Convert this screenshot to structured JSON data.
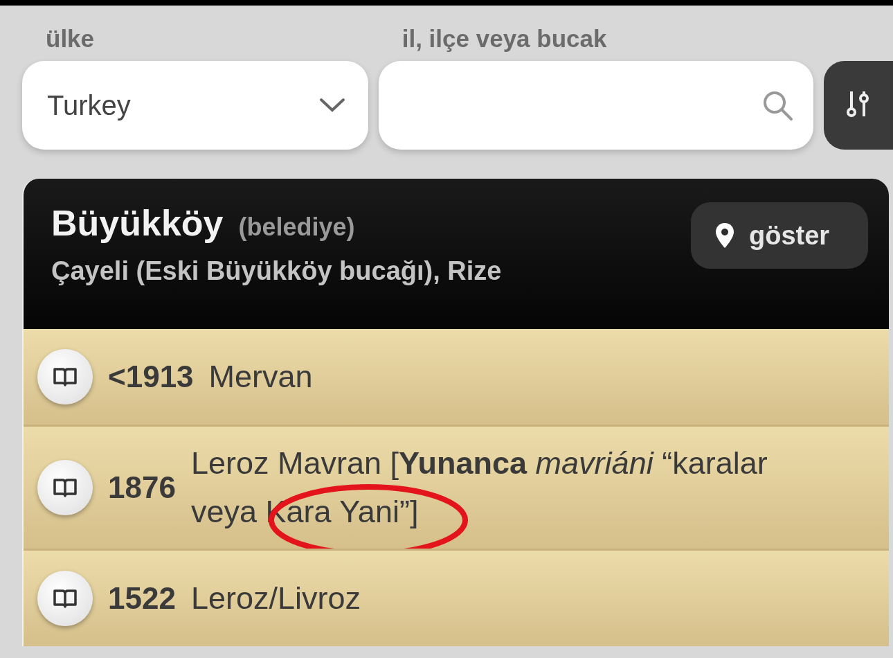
{
  "country_field": {
    "label": "ülke",
    "value": "Turkey"
  },
  "location_field": {
    "label": "il, ilçe veya bucak"
  },
  "place": {
    "name": "Büyükköy",
    "type": "(belediye)",
    "location": "Çayeli (Eski Büyükköy bucağı), Rize",
    "show_button": "göster"
  },
  "names": [
    {
      "year": "<1913",
      "text": "Mervan"
    },
    {
      "year": "1876",
      "text": "Leroz Mavran [**Yunanca** *mavriáni* “karalar veya Kara Yani”]",
      "annotated": true
    },
    {
      "year": "1522",
      "text": "Leroz/Livroz"
    }
  ],
  "annotation": {
    "kind": "ellipse",
    "color": "#e3141b"
  }
}
